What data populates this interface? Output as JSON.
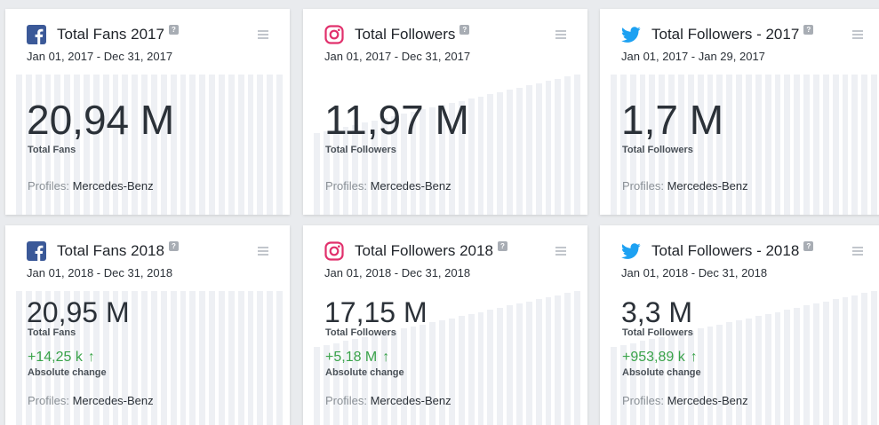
{
  "cards": [
    {
      "network": "facebook",
      "icon": "facebook-icon",
      "title": "Total Fans 2017",
      "help": "?",
      "date_range": "Jan 01, 2017 - Dec 31, 2017",
      "value": "20,94 M",
      "value_label": "Total Fans",
      "profiles_label": "Profiles:",
      "profile": "Mercedes-Benz",
      "trend": "flat"
    },
    {
      "network": "instagram",
      "icon": "instagram-icon",
      "title": "Total Followers",
      "help": "?",
      "date_range": "Jan 01, 2017 - Dec 31, 2017",
      "value": "11,97 M",
      "value_label": "Total Followers",
      "profiles_label": "Profiles:",
      "profile": "Mercedes-Benz",
      "trend": "rising"
    },
    {
      "network": "twitter",
      "icon": "twitter-icon",
      "title": "Total Followers - 2017",
      "help": "?",
      "date_range": "Jan 01, 2017 - Jan 29, 2017",
      "value": "1,7 M",
      "value_label": "Total Followers",
      "profiles_label": "Profiles:",
      "profile": "Mercedes-Benz",
      "trend": "flat"
    },
    {
      "network": "facebook",
      "icon": "facebook-icon",
      "title": "Total Fans 2018",
      "help": "?",
      "date_range": "Jan 01, 2018 - Dec 31, 2018",
      "value": "20,95 M",
      "value_label": "Total Fans",
      "change": "+14,25 k",
      "change_arrow": "↑",
      "change_label": "Absolute change",
      "profiles_label": "Profiles:",
      "profile": "Mercedes-Benz",
      "trend": "flat"
    },
    {
      "network": "instagram",
      "icon": "instagram-icon",
      "title": "Total Followers 2018",
      "help": "?",
      "date_range": "Jan 01, 2018 - Dec 31, 2018",
      "value": "17,15 M",
      "value_label": "Total Followers",
      "change": "+5,18 M",
      "change_arrow": "↑",
      "change_label": "Absolute change",
      "profiles_label": "Profiles:",
      "profile": "Mercedes-Benz",
      "trend": "rising"
    },
    {
      "network": "twitter",
      "icon": "twitter-icon",
      "title": "Total Followers - 2018",
      "help": "?",
      "date_range": "Jan 01, 2018 - Dec 31, 2018",
      "value": "3,3 M",
      "value_label": "Total Followers",
      "change": "+953,89 k",
      "change_arrow": "↑",
      "change_label": "Absolute change",
      "profiles_label": "Profiles:",
      "profile": "Mercedes-Benz",
      "trend": "rising"
    }
  ],
  "colors": {
    "facebook": "#3b5998",
    "instagram": "#e1306c",
    "twitter": "#1da1f2",
    "positive_change": "#3aa34a",
    "bar": "#eef0f4"
  }
}
